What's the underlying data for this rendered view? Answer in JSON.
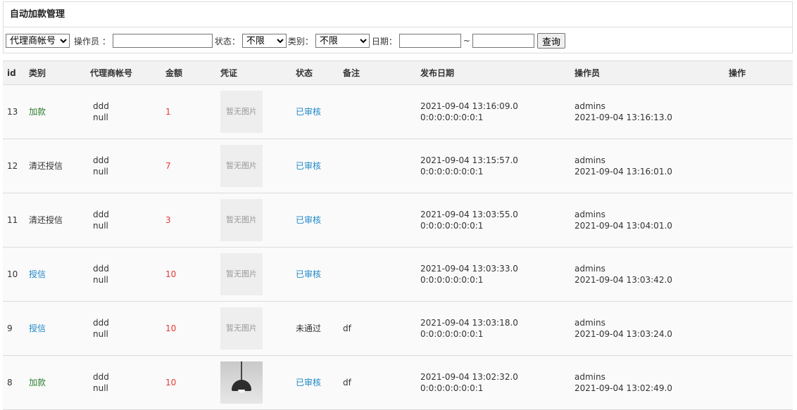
{
  "panel": {
    "title": "自动加款管理"
  },
  "filters": {
    "agent_select": "代理商帐号",
    "operator_label": "操作员 ：",
    "status_label": "状态：",
    "status_value": "不限",
    "category_label": "类别：",
    "category_value": "不限",
    "date_label": "日期：",
    "date_sep": "~",
    "query_button": "查询"
  },
  "table": {
    "headers": [
      "id",
      "类别",
      "代理商帐号",
      "金额",
      "凭证",
      "状态",
      "备注",
      "发布日期",
      "操作员",
      "操作"
    ],
    "no_image_text": "暂无图片",
    "rows": [
      {
        "id": "13",
        "category": "加款",
        "category_color": "#2e7d32",
        "account": "ddd",
        "account2": "null",
        "amount": "1",
        "image": "none",
        "status": "已审核",
        "status_color": "#1e88c8",
        "remark": "",
        "date": "2021-09-04 13:16:09.0",
        "date2": "0:0:0:0:0:0:0:1",
        "operator": "admins",
        "op_date": "2021-09-04 13:16:13.0"
      },
      {
        "id": "12",
        "category": "清还授信",
        "category_color": "#333333",
        "account": "ddd",
        "account2": "null",
        "amount": "7",
        "image": "none",
        "status": "已审核",
        "status_color": "#1e88c8",
        "remark": "",
        "date": "2021-09-04 13:15:57.0",
        "date2": "0:0:0:0:0:0:0:1",
        "operator": "admins",
        "op_date": "2021-09-04 13:16:01.0"
      },
      {
        "id": "11",
        "category": "清还授信",
        "category_color": "#333333",
        "account": "ddd",
        "account2": "null",
        "amount": "3",
        "image": "none",
        "status": "已审核",
        "status_color": "#1e88c8",
        "remark": "",
        "date": "2021-09-04 13:03:55.0",
        "date2": "0:0:0:0:0:0:0:1",
        "operator": "admins",
        "op_date": "2021-09-04 13:04:01.0"
      },
      {
        "id": "10",
        "category": "授信",
        "category_color": "#1e88c8",
        "account": "ddd",
        "account2": "null",
        "amount": "10",
        "image": "none",
        "status": "已审核",
        "status_color": "#1e88c8",
        "remark": "",
        "date": "2021-09-04 13:03:33.0",
        "date2": "0:0:0:0:0:0:0:1",
        "operator": "admins",
        "op_date": "2021-09-04 13:03:42.0"
      },
      {
        "id": "9",
        "category": "授信",
        "category_color": "#1e88c8",
        "account": "ddd",
        "account2": "null",
        "amount": "10",
        "image": "none",
        "status": "未通过",
        "status_color": "#333333",
        "remark": "df",
        "date": "2021-09-04 13:03:18.0",
        "date2": "0:0:0:0:0:0:0:1",
        "operator": "admins",
        "op_date": "2021-09-04 13:03:24.0"
      },
      {
        "id": "8",
        "category": "加款",
        "category_color": "#2e7d32",
        "account": "ddd",
        "account2": "null",
        "amount": "10",
        "image": "lamp-photo",
        "status": "已审核",
        "status_color": "#1e88c8",
        "remark": "df",
        "date": "2021-09-04 13:02:32.0",
        "date2": "0:0:0:0:0:0:0:1",
        "operator": "admins",
        "op_date": "2021-09-04 13:02:49.0"
      }
    ]
  },
  "colors": {
    "amount": "#e53935"
  }
}
